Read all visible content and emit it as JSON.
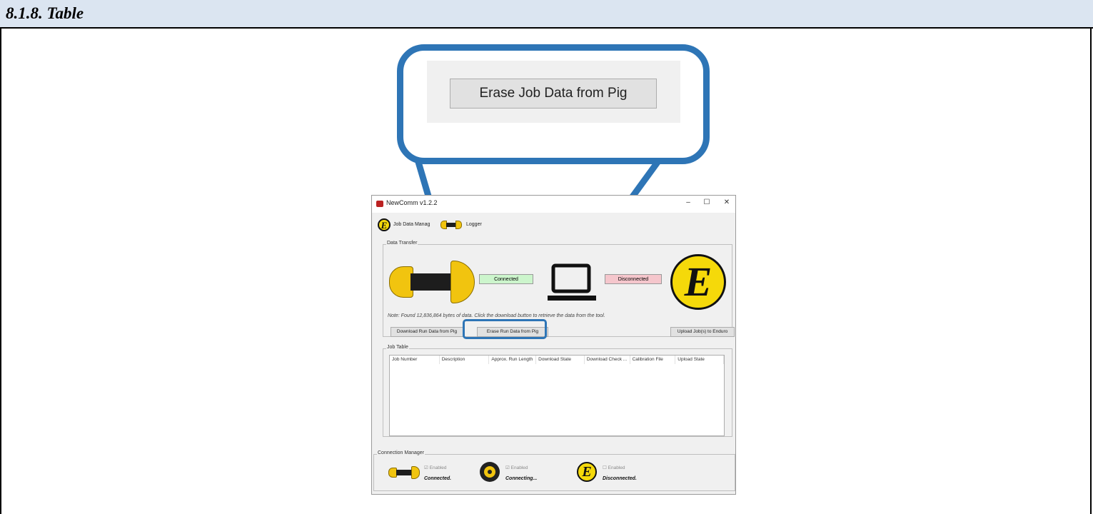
{
  "document": {
    "section_title": "8.1.8. Table"
  },
  "zoom": {
    "button_label": "Erase Job Data from Pig"
  },
  "app": {
    "title": "NewComm v1.2.2",
    "window_controls": {
      "minimize": "–",
      "maximize": "☐",
      "close": "✕"
    },
    "tabs": [
      {
        "label": "Job Data Manag",
        "icon": "e-logo-icon"
      },
      {
        "label": "Logger",
        "icon": "pig-icon"
      }
    ],
    "data_transfer": {
      "title": "Data Transfer",
      "pig_status": "Connected",
      "enduro_status": "Disconnected",
      "note": "Note: Found 12,836,864 bytes of data. Click the download button to retrieve the data from the tool.",
      "download_button": "Download Run Data from Pig",
      "erase_button": "Erase Run Data from Pig",
      "upload_button": "Upload Job(s) to Enduro"
    },
    "job_table": {
      "title": "Job Table",
      "columns": [
        "Job Number",
        "Description",
        "Approx. Run Length",
        "Download State",
        "Download Check ...",
        "Calibration File",
        "Upload State"
      ],
      "rows": []
    },
    "connection_manager": {
      "title": "Connection Manager",
      "items": [
        {
          "icon": "pig-icon",
          "enabled_label": "Enabled",
          "status": "Connected."
        },
        {
          "icon": "receiver-icon",
          "enabled_label": "Enabled",
          "status": "Connecting..."
        },
        {
          "icon": "e-logo-icon",
          "enabled_label": "Enabled",
          "status": "Disconnected."
        }
      ]
    }
  },
  "colors": {
    "header_band": "#dbe5f1",
    "callout_blue": "#2e75b6",
    "connected_green": "#ccf5cc",
    "disconnected_red": "#f5c6cc",
    "logo_yellow": "#f5d90a"
  }
}
